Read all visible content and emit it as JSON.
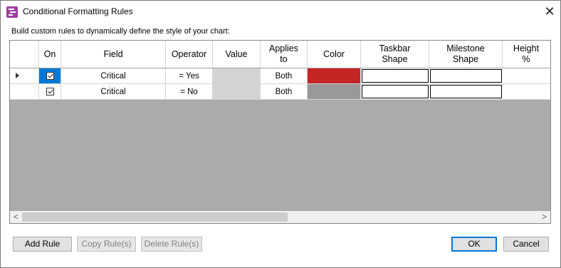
{
  "window": {
    "title": "Conditional Formatting Rules",
    "close_glyph": "✕"
  },
  "description": "Build custom rules to dynamically define the style of your chart:",
  "table": {
    "columns": [
      "On",
      "Field",
      "Operator",
      "Value",
      "Applies\nto",
      "Color",
      "Taskbar\nShape",
      "Milestone\nShape",
      "Height\n%"
    ],
    "rows": [
      {
        "on": true,
        "field": "Critical",
        "operator": "= Yes",
        "value": "",
        "applies_to": "Both",
        "color": "#c42525",
        "taskbar_shape": "",
        "milestone_shape": "",
        "height": ""
      },
      {
        "on": true,
        "field": "Critical",
        "operator": "= No",
        "value": "",
        "applies_to": "Both",
        "color": "#999999",
        "taskbar_shape": "",
        "milestone_shape": "",
        "height": ""
      }
    ]
  },
  "scrollbar": {
    "left_glyph": "<",
    "right_glyph": ">"
  },
  "buttons": {
    "add_rule": "Add Rule",
    "copy_rules": "Copy Rule(s)",
    "delete_rules": "Delete Rule(s)",
    "ok": "OK",
    "cancel": "Cancel"
  },
  "colors": {
    "selection": "#0078d7",
    "grid_background": "#ababab",
    "app_icon": "#9b3fa0"
  }
}
